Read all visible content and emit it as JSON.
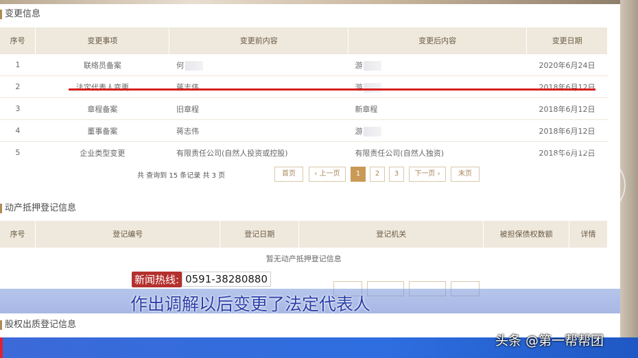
{
  "change_info": {
    "title": "变更信息",
    "columns": [
      "序号",
      "变更事项",
      "变更前内容",
      "变更后内容",
      "变更日期"
    ],
    "rows": [
      {
        "no": "1",
        "item": "联络员备案",
        "before": "何",
        "after": "游",
        "date": "2020年6月24日"
      },
      {
        "no": "2",
        "item": "法定代表人变更",
        "before": "蒋志伟",
        "after": "游",
        "date": "2018年6月12日"
      },
      {
        "no": "3",
        "item": "章程备案",
        "before": "旧章程",
        "after": "新章程",
        "date": "2018年6月12日"
      },
      {
        "no": "4",
        "item": "董事备案",
        "before": "蒋志伟",
        "after": "游",
        "date": "2018年6月12日"
      },
      {
        "no": "5",
        "item": "企业类型变更",
        "before": "有限责任公司(自然人投资或控股)",
        "after": "有限责任公司(自然人独资)",
        "date": "2018年6月12日"
      }
    ],
    "pagination": {
      "summary": "共 查询到 15 条记录 共 3 页",
      "first": "首页",
      "prev": "‹ 上一页",
      "pages": [
        "1",
        "2",
        "3"
      ],
      "current": "1",
      "next": "下一页 ›",
      "last": "末页"
    }
  },
  "mortgage_info": {
    "title": "动产抵押登记信息",
    "columns": [
      "序号",
      "登记编号",
      "登记日期",
      "登记机关",
      "被担保债权数额",
      "详情"
    ],
    "empty_text": "暂无动产抵押登记信息"
  },
  "equity_info": {
    "title": "股权出质登记信息"
  },
  "overlay": {
    "hotline_label": "新闻热线:",
    "hotline_number": "0591-38280880",
    "caption": "作出调解以后变更了法定代表人",
    "watermark": "头条 @第一帮帮团",
    "stamp_text": "帮帮团"
  },
  "colors": {
    "accent": "#c99a55",
    "highlight_line": "#d81e1e",
    "header_bg": "#efe9dd",
    "caption_text": "#2a3fa8"
  }
}
